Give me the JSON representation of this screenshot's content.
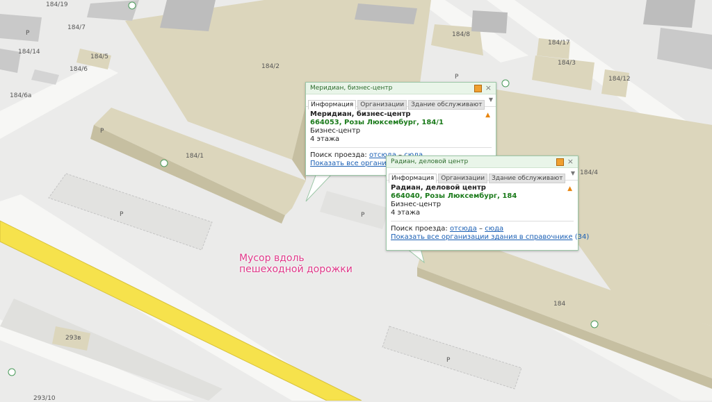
{
  "labels": {
    "b184_19": "184/19",
    "b184_7": "184/7",
    "b184_14": "184/14",
    "b184_5": "184/5",
    "b184_6": "184/6",
    "b184_6a": "184/6а",
    "b184_2": "184/2",
    "b184_8": "184/8",
    "b184_17": "184/17",
    "b184_3": "184/3",
    "b184_12": "184/12",
    "b184_1": "184/1",
    "b184_4": "184/4",
    "b184": "184",
    "b293v": "293в",
    "b293_10": "293/10",
    "parking": "P"
  },
  "annotation": {
    "line1": "Мусор вдоль",
    "line2": "пешеходной дорожки"
  },
  "popup1": {
    "title": "Меридиан, бизнес-центр",
    "tabs": [
      "Информация",
      "Организации",
      "Здание обслуживают"
    ],
    "name": "Меридиан, бизнес-центр",
    "address": "664053, Розы Люксембург, 184/1",
    "type": "Бизнес-центр",
    "floors": "4 этажа",
    "route_label": "Поиск проезда:",
    "route_from": "отсюда",
    "route_sep": "–",
    "route_to": "сюда",
    "show_all": "Показать все организации здания в справочнике"
  },
  "popup2": {
    "title": "Радиан, деловой центр",
    "tabs": [
      "Информация",
      "Организации",
      "Здание обслуживают"
    ],
    "name": "Радиан, деловой центр",
    "address": "664040, Розы Люксембург, 184",
    "type": "Бизнес-центр",
    "floors": "4 этажа",
    "route_label": "Поиск проезда:",
    "route_from": "отсюда",
    "route_sep": "–",
    "route_to": "сюда",
    "show_all": "Показать все организации здания в справочнике",
    "count": "(34)"
  },
  "colors": {
    "ground": "#ebebea",
    "road": "#f7f7f5",
    "main_road": "#f6e24c",
    "building_top": "#dcd6bc",
    "building_side": "#c6bfa1",
    "gray_building": "#bdbdbd",
    "annotation": "#e0398a",
    "popup_border": "#9cc7a7"
  }
}
